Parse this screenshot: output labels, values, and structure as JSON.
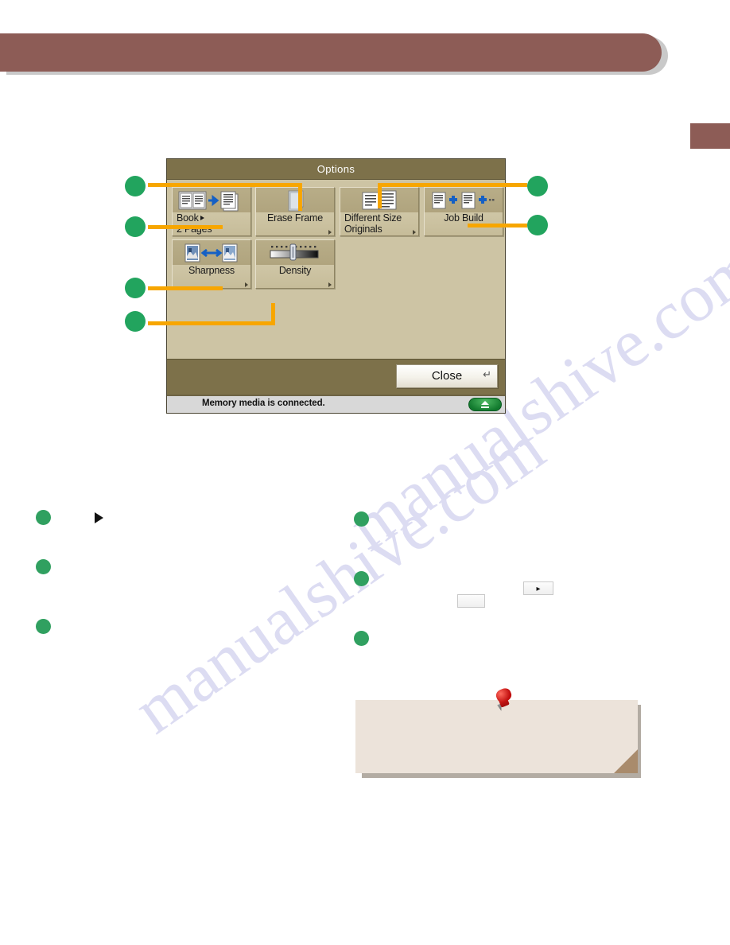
{
  "header": {
    "banner_title": "",
    "banner_color": "#8d5c56",
    "side_tab_color": "#8d5c56"
  },
  "lcd": {
    "title": "Options",
    "title_bar_color": "#7d714a",
    "body_color": "#cdc4a4",
    "options": [
      {
        "id": "book-2-pages",
        "label_line1": "Book",
        "label_line2": "2 Pages",
        "has_inline_arrow": true,
        "has_corner_arrow": false,
        "icon": "book-to-two-pages-icon"
      },
      {
        "id": "erase-frame",
        "label_line1": "Erase Frame",
        "label_line2": "",
        "has_inline_arrow": false,
        "has_corner_arrow": true,
        "icon": "page-frame-icon"
      },
      {
        "id": "different-size-originals",
        "label_line1": "Different Size",
        "label_line2": "Originals",
        "has_inline_arrow": false,
        "has_corner_arrow": true,
        "icon": "two-different-pages-icon"
      },
      {
        "id": "job-build",
        "label_line1": "Job Build",
        "label_line2": "",
        "has_inline_arrow": false,
        "has_corner_arrow": false,
        "icon": "pages-plus-icon"
      },
      {
        "id": "sharpness",
        "label_line1": "Sharpness",
        "label_line2": "",
        "has_inline_arrow": false,
        "has_corner_arrow": true,
        "icon": "sharpness-images-icon"
      },
      {
        "id": "density",
        "label_line1": "Density",
        "label_line2": "",
        "has_inline_arrow": false,
        "has_corner_arrow": true,
        "icon": "density-slider-icon"
      }
    ],
    "close_label": "Close",
    "close_return_glyph": "↵",
    "status_text": "Memory media is connected.",
    "eject_icon": "eject-icon"
  },
  "callouts": {
    "marker_color": "#22a45e",
    "line_color": "#f7a600",
    "left": [
      {
        "id": "callout-1",
        "target": "book-2-pages-top-edge"
      },
      {
        "id": "callout-2",
        "target": "book-2-pages"
      },
      {
        "id": "callout-3",
        "target": "sharpness"
      },
      {
        "id": "callout-4",
        "target": "density"
      }
    ],
    "right": [
      {
        "id": "callout-5",
        "target": "different-size-originals"
      },
      {
        "id": "callout-6",
        "target": "job-build"
      }
    ]
  },
  "steps": {
    "dot_color": "#30a060",
    "left_column": [
      {
        "id": "step-left-1",
        "text": "",
        "has_play_glyph": true
      },
      {
        "id": "step-left-2",
        "text": ""
      },
      {
        "id": "step-left-3",
        "text": ""
      }
    ],
    "right_column": [
      {
        "id": "step-right-1",
        "text": ""
      },
      {
        "id": "step-right-2",
        "text": "",
        "keys": [
          {
            "id": "key-small-blank",
            "glyph": ""
          },
          {
            "id": "key-right-arrow",
            "glyph": "▸"
          }
        ]
      },
      {
        "id": "step-right-3",
        "text": ""
      }
    ]
  },
  "note": {
    "text": "",
    "pin_icon": "pushpin-icon",
    "background": "#ece3da"
  },
  "watermark": {
    "line1": "manualshive.com",
    "line2": "manualshive.com"
  }
}
